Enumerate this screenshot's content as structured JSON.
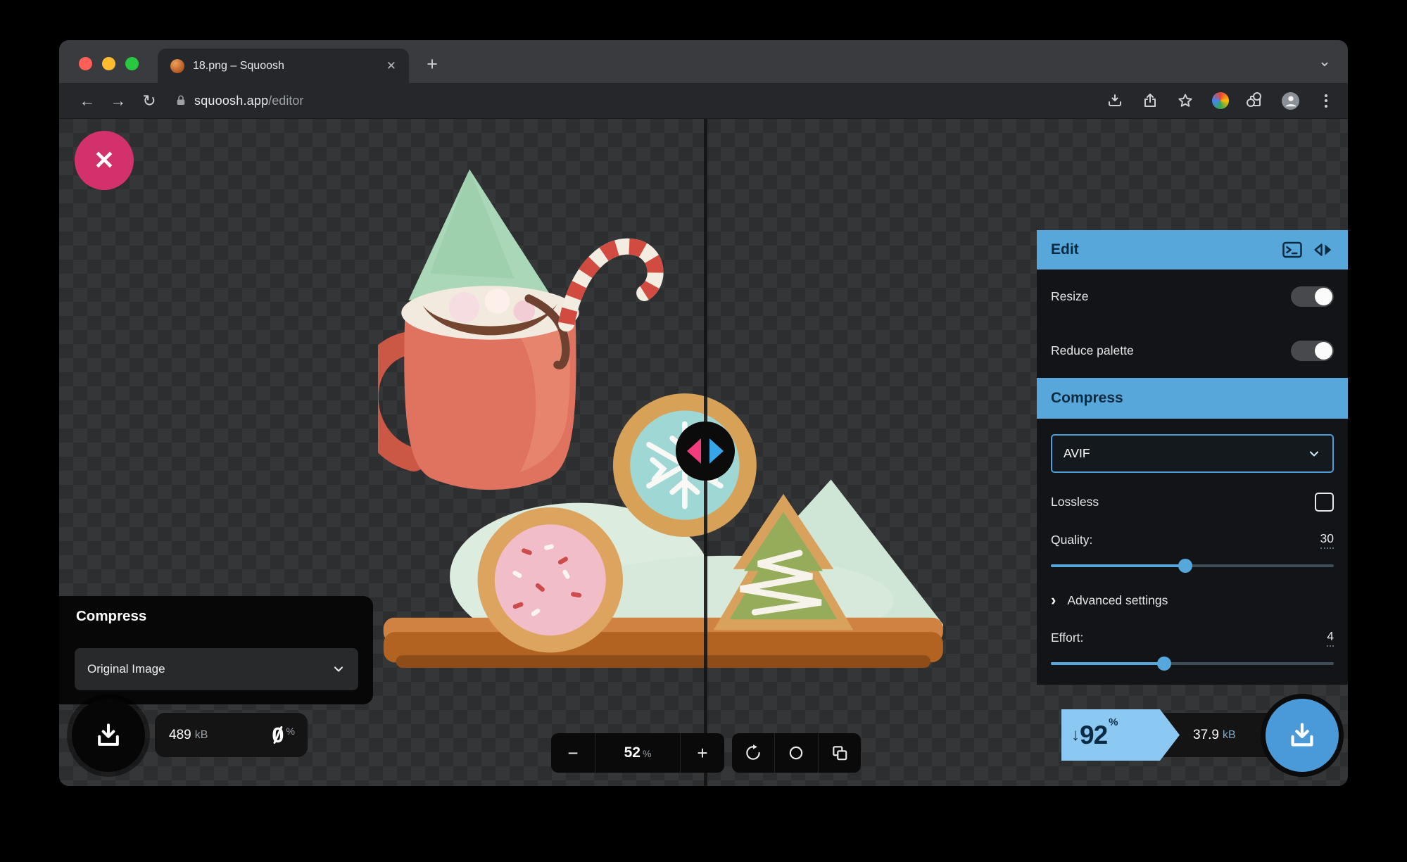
{
  "colors": {
    "accent_blue": "#55a7dc",
    "badge_blue": "#8bc9f3",
    "close_pink": "#d2316b",
    "traffic_red": "#ff5f57",
    "traffic_yellow": "#febc2e",
    "traffic_green": "#28c840"
  },
  "chrome": {
    "tab": {
      "title": "18.png – Squoosh",
      "close_glyph": "✕"
    },
    "new_tab_glyph": "+",
    "window_chevron_glyph": "⌄",
    "nav": {
      "back_glyph": "←",
      "forward_glyph": "→",
      "reload_glyph": "↻"
    },
    "address": {
      "host": "squoosh.app",
      "path": "/editor"
    }
  },
  "editor": {
    "close_glyph": "✕",
    "edit": {
      "title": "Edit",
      "rows": [
        {
          "label": "Resize",
          "on": false
        },
        {
          "label": "Reduce palette",
          "on": false
        }
      ]
    },
    "compress": {
      "title": "Compress",
      "codec": "AVIF",
      "lossless_label": "Lossless",
      "lossless_checked": false,
      "quality_label": "Quality:",
      "quality_value": "30",
      "quality_fraction": 0.476,
      "advanced_glyph": "›",
      "advanced_label": "Advanced settings",
      "effort_label": "Effort:",
      "effort_value": "4",
      "effort_fraction": 0.4
    },
    "left_result": {
      "panel_title": "Compress",
      "select_value": "Original Image",
      "size_value": "489",
      "size_unit": "kB",
      "delta_value": "0",
      "delta_unit": "%"
    },
    "zoom": {
      "minus_glyph": "−",
      "value": "52",
      "unit": "%",
      "plus_glyph": "+"
    },
    "right_result": {
      "arrow_glyph": "↓",
      "delta_value": "92",
      "delta_unit": "%",
      "size_value": "37.9",
      "size_unit": "kB"
    }
  }
}
